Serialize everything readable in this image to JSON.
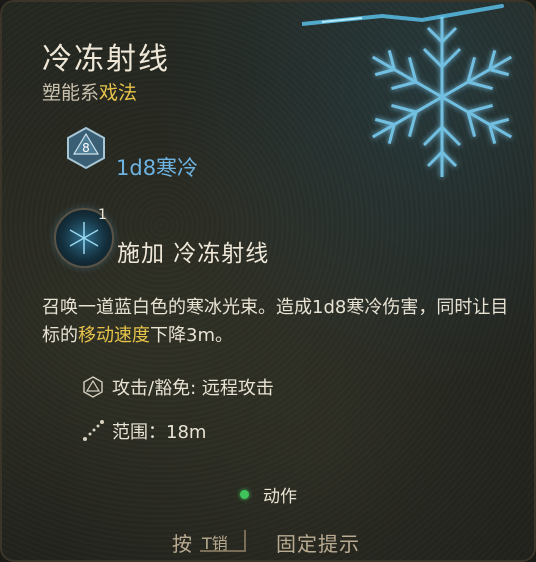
{
  "spell": {
    "name": "冷冻射线",
    "school_prefix": "塑能系",
    "school_type": "戏法"
  },
  "damage": {
    "die_value": "8",
    "text": "1d8寒冷"
  },
  "cast": {
    "count": "1",
    "label": "施加 冷冻射线"
  },
  "description": {
    "part1": "召唤一道蓝白色的寒冰光束。造成1d8寒冷伤害，同时让目标的",
    "highlight": "移动速度",
    "part2": "下降3m。"
  },
  "attributes": {
    "attack_label": "攻击/豁免: 远程攻击",
    "range_label": "范围：18m"
  },
  "action": {
    "label": "动作"
  },
  "footer": {
    "press": "按",
    "key": "T销",
    "pin": "固定提示"
  },
  "icons": {
    "die": "d20-die-icon",
    "spell": "ray-of-frost-spell-icon",
    "attack": "d20-outline-icon",
    "range": "dotted-line-range-icon",
    "action": "green-action-dot-icon",
    "snowflake": "snowflake-decor-icon"
  },
  "colors": {
    "title": "#efe8d9",
    "accent": "#e6c34a",
    "damage_blue": "#6db3e2",
    "action_green": "#3ec45a",
    "footer_text": "#b9ab91"
  }
}
